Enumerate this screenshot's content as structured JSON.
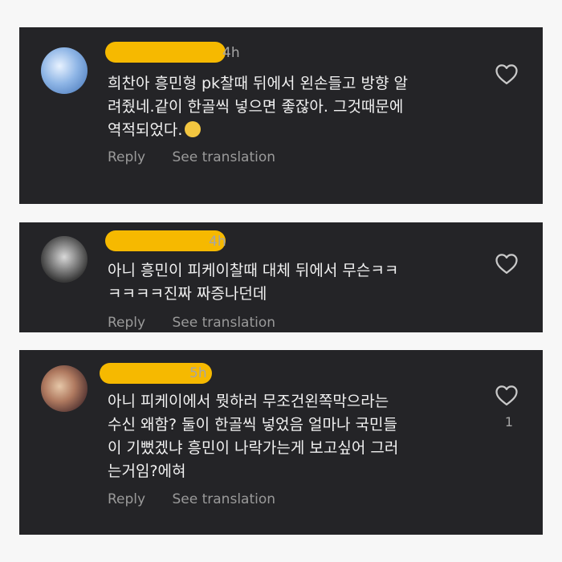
{
  "comments": [
    {
      "time": "4h",
      "lines": [
        "희찬아 흥민형 pk찰때 뒤에서 왼손들고 방향 알",
        "려줬네.같이 한골씩 넣으면 좋잖아. 그것때문에",
        "역적되었다."
      ],
      "reply": "Reply",
      "translate": "See translation",
      "likes": ""
    },
    {
      "time": "4h",
      "lines": [
        "아니 흥민이 피케이찰때 대체 뒤에서 무슨ㅋㅋ",
        "ㅋㅋㅋㅋ진짜 짜증나던데"
      ],
      "reply": "Reply",
      "translate": "See translation",
      "likes": ""
    },
    {
      "time": "5h",
      "lines": [
        "아니 피케이에서 뭣하러 무조건왼쪽막으라는",
        "수신 왜함? 둘이 한골씩 넣었음 얼마나 국민들",
        "이 기뻤겠냐 흥민이 나락가는게 보고싶어 그러",
        "는거임?에혀"
      ],
      "reply": "Reply",
      "translate": "See translation",
      "likes": "1"
    }
  ],
  "icons": {
    "like": "heart-outline-icon",
    "emoji": "face-holding-back-tears-emoji"
  },
  "colors": {
    "card_bg": "#242427",
    "page_bg": "#f7f7f7",
    "text": "#f1f1f1",
    "meta": "#9a9a9a",
    "redaction": "#f6b900"
  }
}
